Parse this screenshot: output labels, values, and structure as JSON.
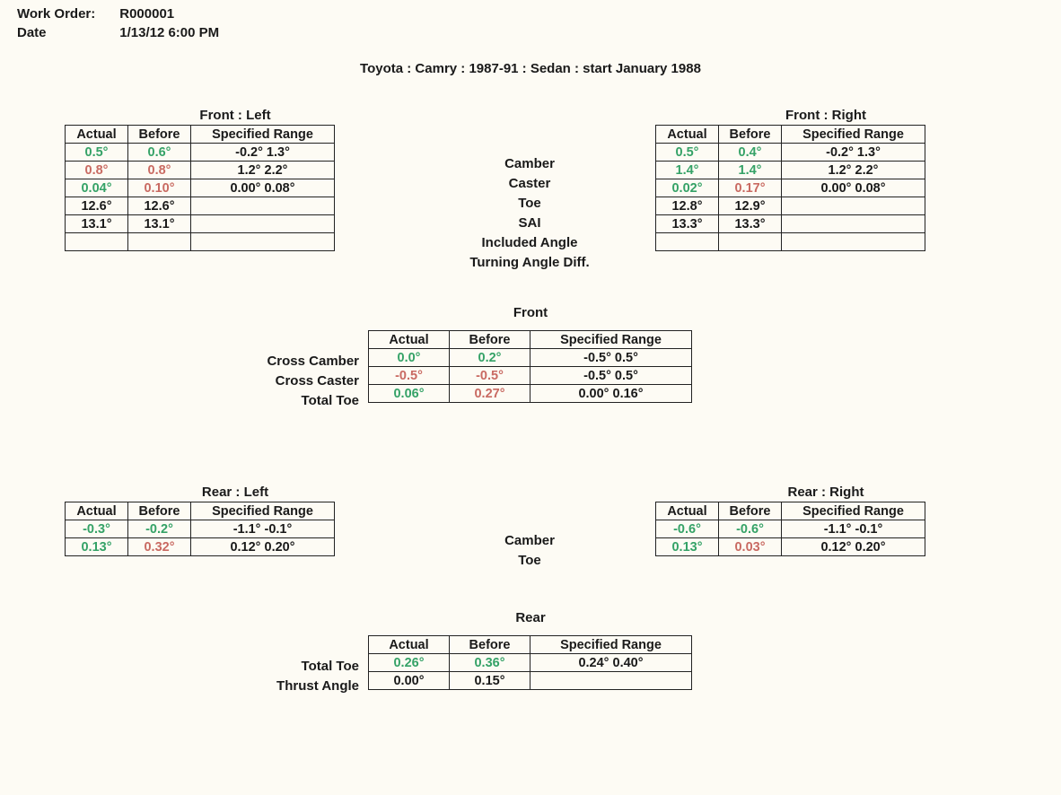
{
  "header": {
    "work_order_label": "Work Order:",
    "work_order": "R000001",
    "date_label": "Date",
    "date": "1/13/12 6:00 PM"
  },
  "vehicle": "Toyota : Camry : 1987-91 : Sedan : start January 1988",
  "col_headers": {
    "actual": "Actual",
    "before": "Before",
    "range": "Specified Range"
  },
  "front_left_title": "Front : Left",
  "front_right_title": "Front : Right",
  "front_center_title": "Front",
  "rear_left_title": "Rear : Left",
  "rear_right_title": "Rear : Right",
  "rear_center_title": "Rear",
  "front_row_labels": [
    "Camber",
    "Caster",
    "Toe",
    "SAI",
    "Included Angle",
    "Turning Angle Diff."
  ],
  "front_cross_labels": [
    "Cross Camber",
    "Cross Caster",
    "Total Toe"
  ],
  "rear_row_labels": [
    "Camber",
    "Toe"
  ],
  "rear_cross_labels": [
    "Total Toe",
    "Thrust Angle"
  ],
  "front_left": [
    {
      "actual": "0.5°",
      "ac": "green",
      "before": "0.6°",
      "bc": "green",
      "range": "-0.2° 1.3°"
    },
    {
      "actual": "0.8°",
      "ac": "red",
      "before": "0.8°",
      "bc": "red",
      "range": "1.2° 2.2°"
    },
    {
      "actual": "0.04°",
      "ac": "green",
      "before": "0.10°",
      "bc": "red",
      "range": "0.00° 0.08°"
    },
    {
      "actual": "12.6°",
      "ac": "blk",
      "before": "12.6°",
      "bc": "blk",
      "range": ""
    },
    {
      "actual": "13.1°",
      "ac": "blk",
      "before": "13.1°",
      "bc": "blk",
      "range": ""
    },
    {
      "actual": "",
      "ac": "blk",
      "before": "",
      "bc": "blk",
      "range": ""
    }
  ],
  "front_right": [
    {
      "actual": "0.5°",
      "ac": "green",
      "before": "0.4°",
      "bc": "green",
      "range": "-0.2° 1.3°"
    },
    {
      "actual": "1.4°",
      "ac": "green",
      "before": "1.4°",
      "bc": "green",
      "range": "1.2° 2.2°"
    },
    {
      "actual": "0.02°",
      "ac": "green",
      "before": "0.17°",
      "bc": "red",
      "range": "0.00° 0.08°"
    },
    {
      "actual": "12.8°",
      "ac": "blk",
      "before": "12.9°",
      "bc": "blk",
      "range": ""
    },
    {
      "actual": "13.3°",
      "ac": "blk",
      "before": "13.3°",
      "bc": "blk",
      "range": ""
    },
    {
      "actual": "",
      "ac": "blk",
      "before": "",
      "bc": "blk",
      "range": ""
    }
  ],
  "front_cross": [
    {
      "actual": "0.0°",
      "ac": "green",
      "before": "0.2°",
      "bc": "green",
      "range": "-0.5° 0.5°"
    },
    {
      "actual": "-0.5°",
      "ac": "red",
      "before": "-0.5°",
      "bc": "red",
      "range": "-0.5° 0.5°"
    },
    {
      "actual": "0.06°",
      "ac": "green",
      "before": "0.27°",
      "bc": "red",
      "range": "0.00° 0.16°"
    }
  ],
  "rear_left": [
    {
      "actual": "-0.3°",
      "ac": "green",
      "before": "-0.2°",
      "bc": "green",
      "range": "-1.1° -0.1°"
    },
    {
      "actual": "0.13°",
      "ac": "green",
      "before": "0.32°",
      "bc": "red",
      "range": "0.12° 0.20°"
    }
  ],
  "rear_right": [
    {
      "actual": "-0.6°",
      "ac": "green",
      "before": "-0.6°",
      "bc": "green",
      "range": "-1.1° -0.1°"
    },
    {
      "actual": "0.13°",
      "ac": "green",
      "before": "0.03°",
      "bc": "red",
      "range": "0.12° 0.20°"
    }
  ],
  "rear_cross": [
    {
      "actual": "0.26°",
      "ac": "green",
      "before": "0.36°",
      "bc": "green",
      "range": "0.24° 0.40°"
    },
    {
      "actual": "0.00°",
      "ac": "blk",
      "before": "0.15°",
      "bc": "blk",
      "range": ""
    }
  ]
}
